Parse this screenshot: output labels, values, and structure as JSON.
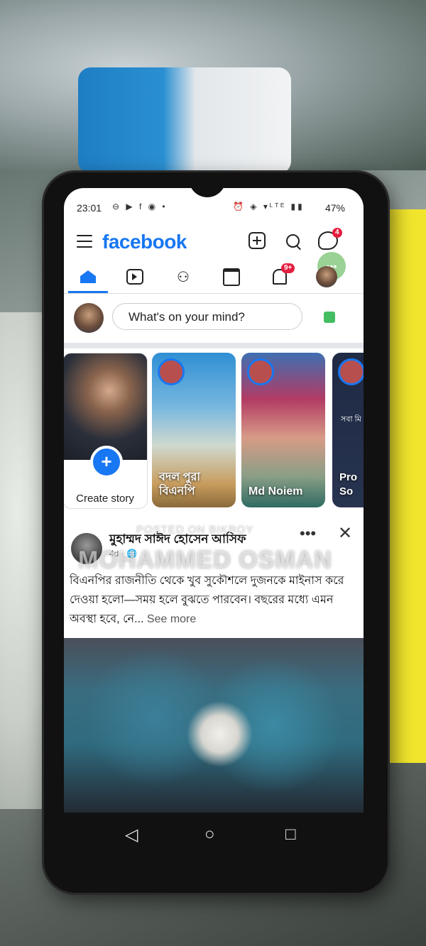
{
  "status_bar": {
    "time": "23:01",
    "left_icons": "⊖ ▶ f ◉ •",
    "right_icons": "⏰ ◈ ▾ᴸᵀᴱ ▮▮",
    "battery": "47%"
  },
  "header": {
    "logo": "facebook",
    "messenger_badge": "4",
    "chat_head_text": "•••"
  },
  "tabs": {
    "notifications_badge": "9+",
    "items": [
      "home",
      "video",
      "friends",
      "marketplace",
      "notifications",
      "profile"
    ]
  },
  "composer": {
    "placeholder": "What's on your mind?"
  },
  "stories": {
    "create_label": "Create story",
    "items": [
      {
        "name": "বদল পুরা বিএনপি"
      },
      {
        "name": "Md Noiem"
      },
      {
        "name": "Pro So"
      }
    ],
    "story4_text": "সবা মি না"
  },
  "post": {
    "author": "মুহাম্মদ সাঈদ হোসেন আসিফ",
    "meta": "4d · 🌐",
    "text": "বিএনপির রাজনীতি থেকে খুব সুকৌশলে দুজনকে মাইনাস করে দেওয়া হলো—সময় হলে বুঝতে পারবেন। বছরের মধ্যে এমন অবস্থা হবে, নে...",
    "see_more": "See more"
  },
  "watermark": {
    "line1": "POSTED ON BIKROY",
    "line2": "MOHAMMED OSMAN"
  },
  "nav": {
    "back": "◁",
    "home": "○",
    "recents": "□"
  },
  "colors": {
    "brand": "#1877f2",
    "badge": "#e41e3f"
  }
}
